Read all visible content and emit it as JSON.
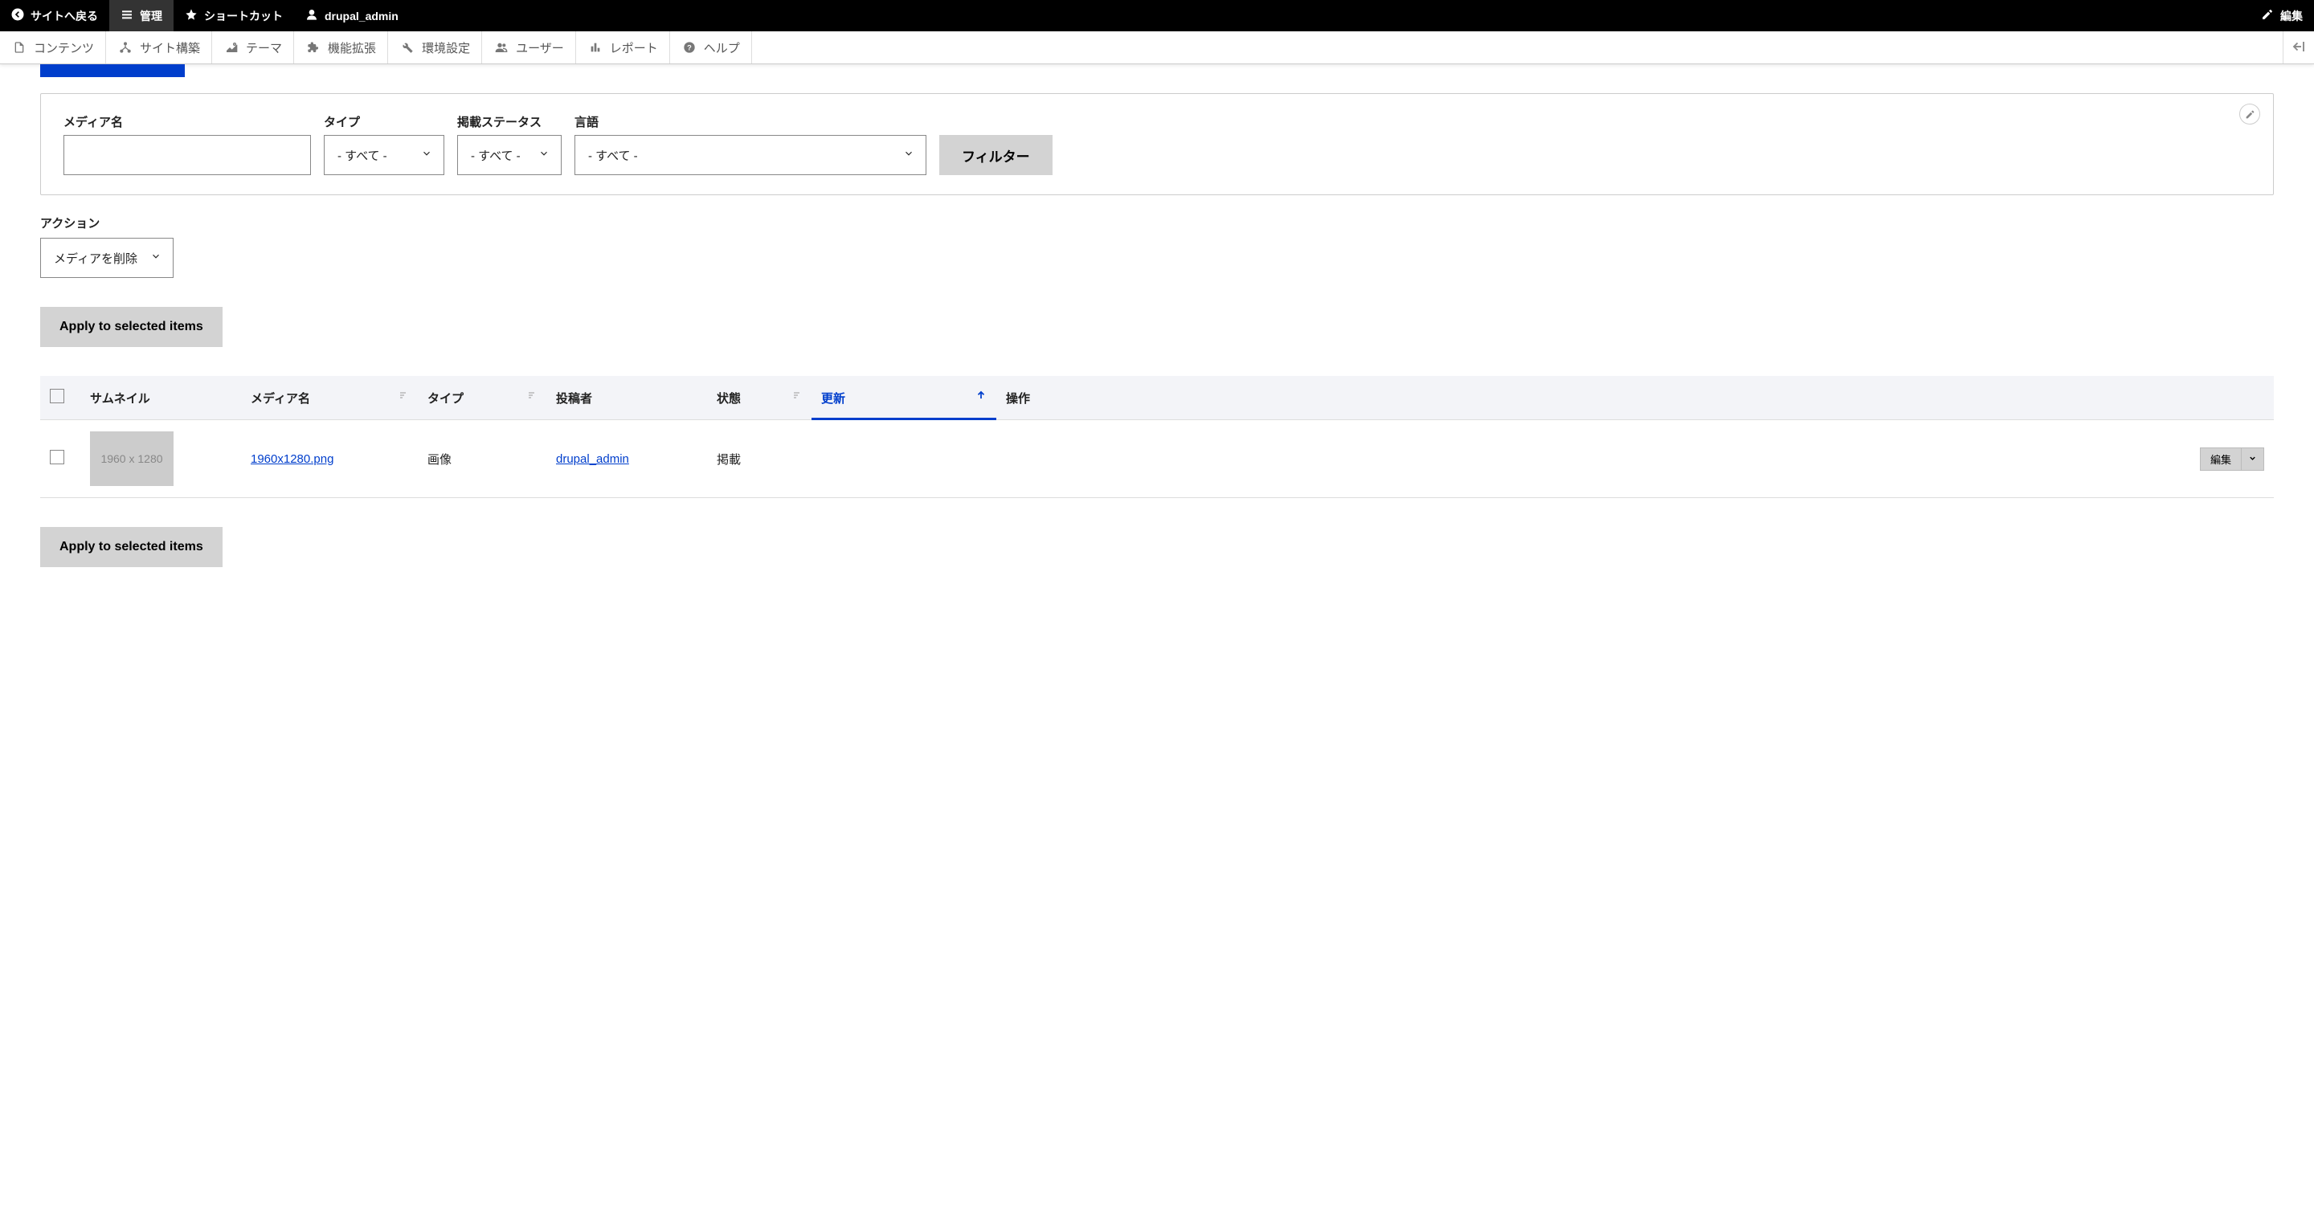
{
  "toolbar_top": {
    "back": "サイトへ戻る",
    "manage": "管理",
    "shortcuts": "ショートカット",
    "user": "drupal_admin",
    "edit": "編集"
  },
  "toolbar_secondary": {
    "content": "コンテンツ",
    "structure": "サイト構築",
    "appearance": "テーマ",
    "extend": "機能拡張",
    "configuration": "環境設定",
    "people": "ユーザー",
    "reports": "レポート",
    "help": "ヘルプ"
  },
  "filters": {
    "media_name_label": "メディア名",
    "type_label": "タイプ",
    "publish_status_label": "掲載ステータス",
    "language_label": "言語",
    "all_option": "- すべて -",
    "filter_button": "フィルター"
  },
  "action": {
    "label": "アクション",
    "selected": "メディアを削除",
    "apply_button": "Apply to selected items"
  },
  "table": {
    "headers": {
      "thumbnail": "サムネイル",
      "media_name": "メディア名",
      "type": "タイプ",
      "author": "投稿者",
      "status": "状態",
      "updated": "更新",
      "operations": "操作"
    },
    "rows": [
      {
        "thumbnail_text": "1960 x 1280",
        "media_name": "1960x1280.png",
        "type": "画像",
        "author": "drupal_admin",
        "status": "掲載",
        "updated": "",
        "op_label": "編集"
      }
    ]
  }
}
